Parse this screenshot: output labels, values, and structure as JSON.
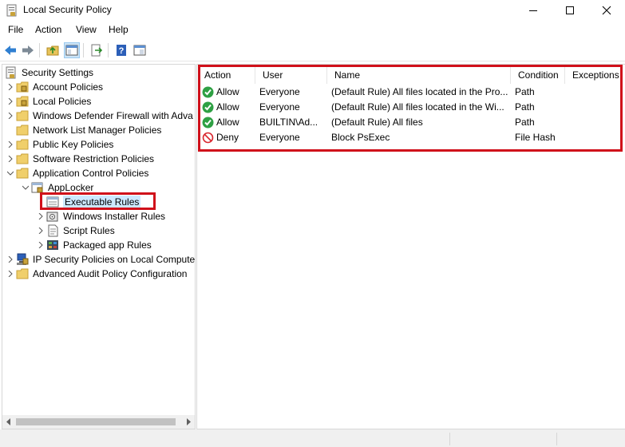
{
  "window": {
    "title": "Local Security Policy",
    "controls": [
      "minimize",
      "maximize",
      "close"
    ]
  },
  "menu": [
    "File",
    "Action",
    "View",
    "Help"
  ],
  "toolbar": [
    "back",
    "forward",
    "up-folder",
    "show-hide-tree",
    "export-list",
    "help",
    "properties"
  ],
  "tree": {
    "root": "Security Settings",
    "items": [
      {
        "label": "Account Policies",
        "icon": "folder-lock-icon"
      },
      {
        "label": "Local Policies",
        "icon": "folder-lock-icon"
      },
      {
        "label": "Windows Defender Firewall with Adva",
        "icon": "folder-icon"
      },
      {
        "label": "Network List Manager Policies",
        "icon": "folder-icon"
      },
      {
        "label": "Public Key Policies",
        "icon": "folder-icon"
      },
      {
        "label": "Software Restriction Policies",
        "icon": "folder-icon"
      },
      {
        "label": "Application Control Policies",
        "icon": "folder-icon"
      },
      {
        "label": "AppLocker",
        "icon": "applocker-icon"
      },
      {
        "label": "Executable Rules",
        "icon": "rules-icon"
      },
      {
        "label": "Windows Installer Rules",
        "icon": "installer-icon"
      },
      {
        "label": "Script Rules",
        "icon": "script-icon"
      },
      {
        "label": "Packaged app Rules",
        "icon": "package-icon"
      },
      {
        "label": "IP Security Policies on Local Compute",
        "icon": "ipsec-icon"
      },
      {
        "label": "Advanced Audit Policy Configuration",
        "icon": "folder-icon"
      }
    ]
  },
  "list": {
    "columns": [
      "Action",
      "User",
      "Name",
      "Condition",
      "Exceptions"
    ],
    "rows": [
      {
        "action": "Allow",
        "status": "allow",
        "user": "Everyone",
        "name": "(Default Rule) All files located in the Pro...",
        "condition": "Path",
        "exceptions": ""
      },
      {
        "action": "Allow",
        "status": "allow",
        "user": "Everyone",
        "name": "(Default Rule) All files located in the Wi...",
        "condition": "Path",
        "exceptions": ""
      },
      {
        "action": "Allow",
        "status": "allow",
        "user": "BUILTIN\\Ad...",
        "name": "(Default Rule) All files",
        "condition": "Path",
        "exceptions": ""
      },
      {
        "action": "Deny",
        "status": "deny",
        "user": "Everyone",
        "name": "Block PsExec",
        "condition": "File Hash",
        "exceptions": ""
      }
    ]
  },
  "colors": {
    "highlight_box": "#d0101a",
    "selection": "#cce8ff",
    "allow": "#2ea043",
    "deny": "#d9262e"
  }
}
